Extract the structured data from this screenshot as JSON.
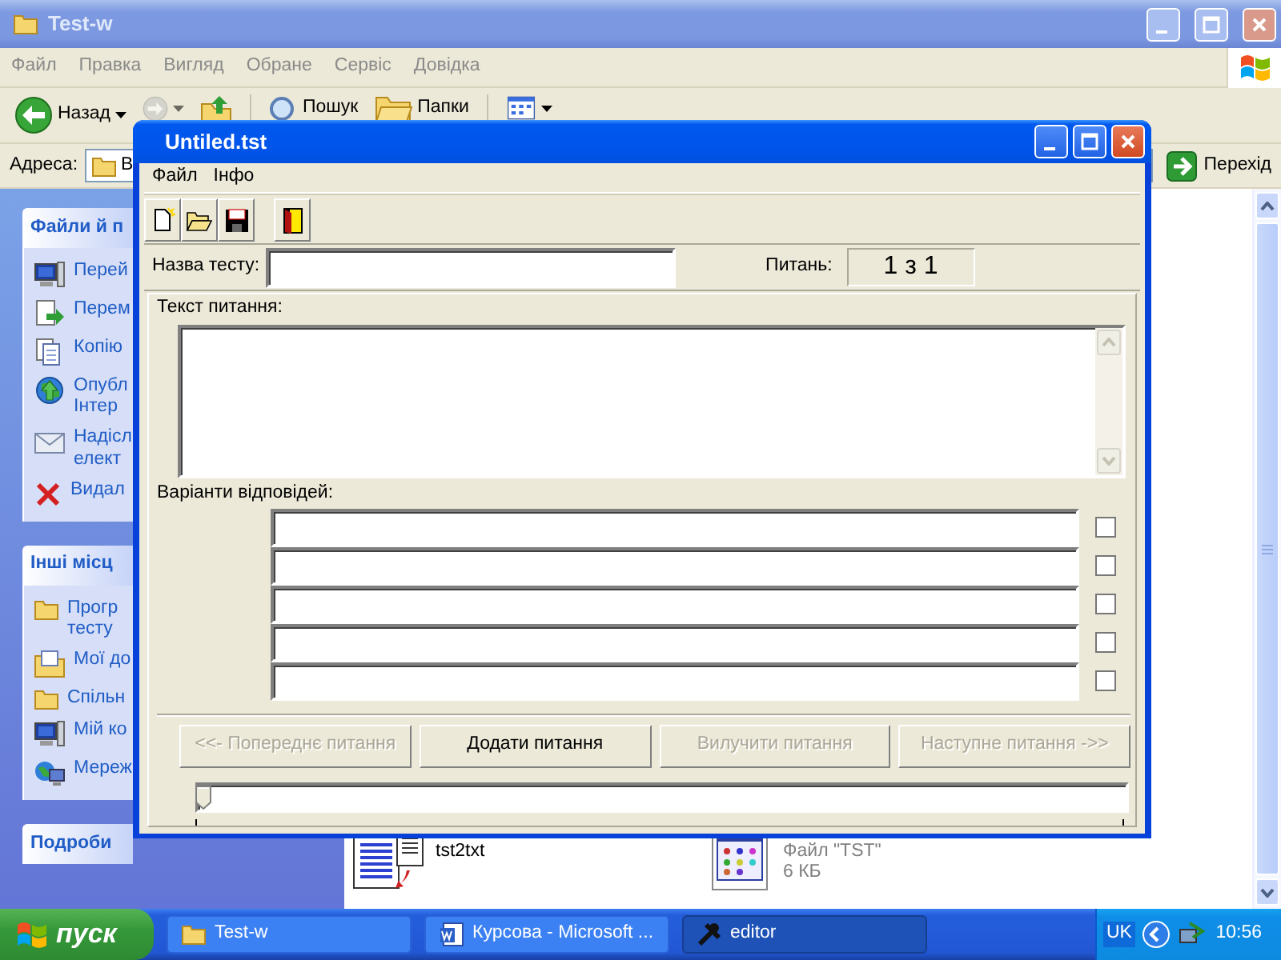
{
  "explorer": {
    "title": "Test-w",
    "menu": [
      "Файл",
      "Правка",
      "Вигляд",
      "Обране",
      "Сервіс",
      "Довідка"
    ],
    "toolbar": [
      {
        "kind": "back",
        "label": "Назад",
        "disabled": false
      },
      {
        "kind": "forward",
        "disabled": true
      },
      {
        "kind": "up",
        "disabled": false
      },
      {
        "kind": "search",
        "label": "Пошук",
        "disabled": false
      },
      {
        "kind": "folders",
        "label": "Папки",
        "disabled": false
      },
      {
        "kind": "views",
        "disabled": false
      }
    ],
    "address": {
      "label": "Адреса:",
      "value": "В",
      "go": "Перехід"
    },
    "task_panes": [
      {
        "title": "Файли й п",
        "items": [
          {
            "lines": [
              "Перей"
            ]
          },
          {
            "lines": [
              "Перем"
            ]
          },
          {
            "lines": [
              "Копію"
            ]
          },
          {
            "lines": [
              "Опубл",
              "Інтер"
            ]
          },
          {
            "lines": [
              "Надісл",
              "елект"
            ]
          },
          {
            "lines": [
              "Видал"
            ]
          }
        ]
      },
      {
        "title": "Інші місц",
        "items": [
          {
            "lines": [
              "Прогр",
              "тесту"
            ]
          },
          {
            "lines": [
              "Мої до"
            ]
          },
          {
            "lines": [
              "Спільн"
            ]
          },
          {
            "lines": [
              "Мій ко"
            ]
          },
          {
            "lines": [
              "Мереж"
            ]
          }
        ]
      },
      {
        "title": "Подроби"
      }
    ],
    "files": [
      {
        "name": "tst2txt"
      },
      {
        "details": [
          "Файл \"TST\"",
          "6 КБ"
        ]
      }
    ]
  },
  "editor": {
    "title": "Untiled.tst",
    "menu": [
      "Файл",
      "Інфо"
    ],
    "test_name": {
      "label": "Назва тесту:"
    },
    "questions": {
      "label": "Питань:",
      "value": "1 з 1"
    },
    "question_text": {
      "label": "Текст питання:"
    },
    "answers": {
      "label": "Варіанти відповідей:",
      "items": [
        {
          "checked": false
        },
        {
          "checked": false
        },
        {
          "checked": false
        },
        {
          "checked": false
        },
        {
          "checked": false
        }
      ]
    },
    "buttons": [
      {
        "label": "<<- Попереднє питання",
        "disabled": true
      },
      {
        "label": "Додати питання",
        "disabled": false
      },
      {
        "label": "Вилучити питання",
        "disabled": true
      },
      {
        "label": "Наступне питання ->>",
        "disabled": true
      }
    ],
    "slider": {
      "level": 0
    }
  },
  "taskbar": {
    "start": "пуск",
    "tasks": [
      {
        "label": "Test-w",
        "selected": false
      },
      {
        "label": "Курсова - Microsoft ...",
        "selected": false
      },
      {
        "label": "editor",
        "selected": true
      }
    ],
    "language": "UK",
    "clock": "10:56"
  }
}
